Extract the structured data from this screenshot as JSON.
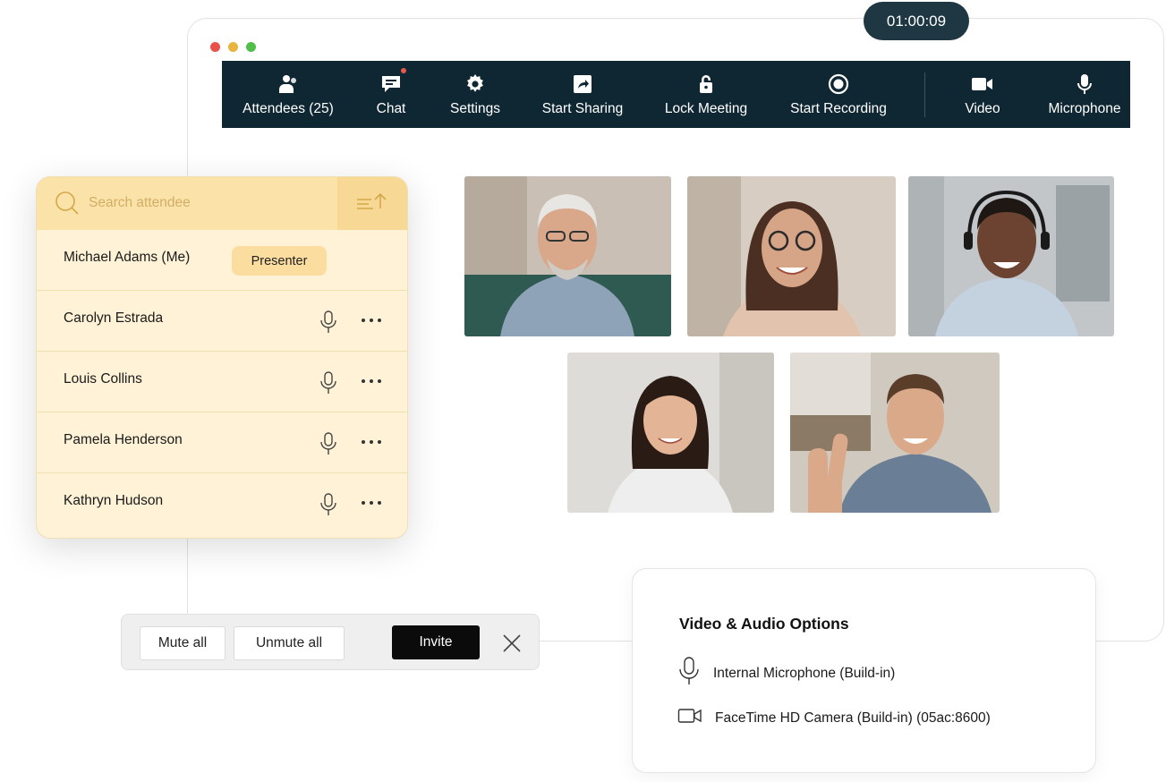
{
  "timer": "01:00:09",
  "window_controls": {
    "close_color": "#e8524a",
    "minimize_color": "#eab33d",
    "maximize_color": "#4fbf4a"
  },
  "toolbar": {
    "background": "#0f2733",
    "items": [
      {
        "label": "Attendees (25)",
        "icon": "attendees-icon"
      },
      {
        "label": "Chat",
        "icon": "chat-icon",
        "has_notification": true
      },
      {
        "label": "Settings",
        "icon": "gear-icon"
      },
      {
        "label": "Start Sharing",
        "icon": "share-icon"
      },
      {
        "label": "Lock Meeting",
        "icon": "lock-icon"
      },
      {
        "label": "Start Recording",
        "icon": "record-icon"
      },
      {
        "label": "Video",
        "icon": "video-camera-icon"
      },
      {
        "label": "Microphone",
        "icon": "microphone-icon"
      }
    ]
  },
  "attendee_panel": {
    "search_placeholder": "Search attendee",
    "presenter_badge": "Presenter",
    "attendees": [
      {
        "name": "Michael Adams (Me)"
      },
      {
        "name": "Carolyn Estrada"
      },
      {
        "name": "Louis Collins"
      },
      {
        "name": "Pamela Henderson"
      },
      {
        "name": "Kathryn Hudson"
      }
    ]
  },
  "actions": {
    "mute_all": "Mute all",
    "unmute_all": "Unmute all",
    "invite": "Invite"
  },
  "av_options": {
    "title": "Video & Audio Options",
    "microphone": "Internal Microphone (Build-in)",
    "camera": "FaceTime HD Camera (Build-in) (05ac:8600)"
  },
  "video_tiles": [
    {
      "participant": "older man with glasses"
    },
    {
      "participant": "woman with glasses"
    },
    {
      "participant": "man with headset"
    },
    {
      "participant": "young woman"
    },
    {
      "participant": "man waving"
    }
  ]
}
